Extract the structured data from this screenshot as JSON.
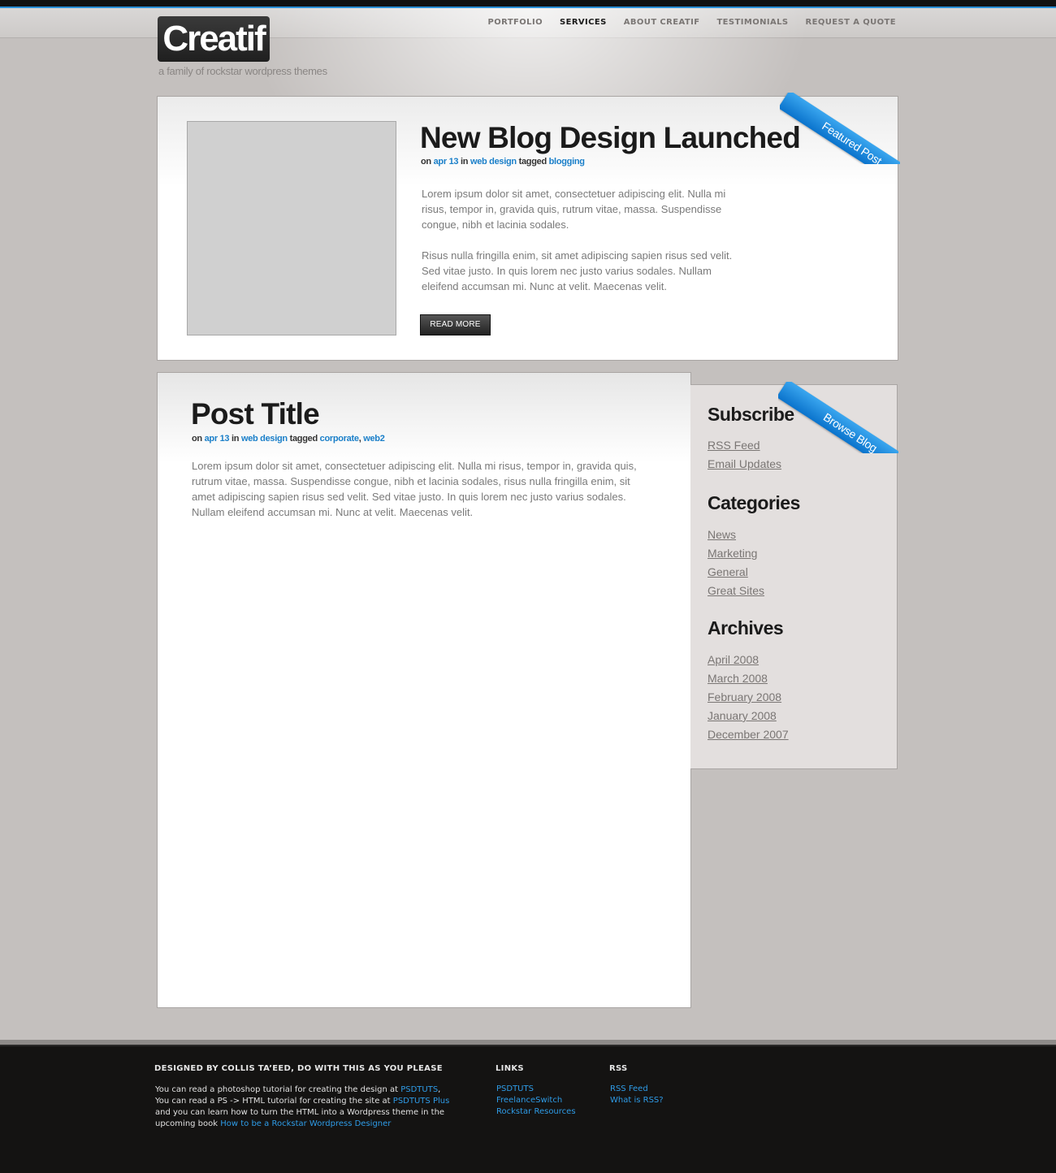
{
  "header": {
    "logo": "Creatif",
    "tagline": "a family of rockstar wordpress themes",
    "nav": [
      "PORTFOLIO",
      "SERVICES",
      "ABOUT CREATIF",
      "TESTIMONIALS",
      "REQUEST A QUOTE"
    ],
    "active_nav": "SERVICES"
  },
  "featured": {
    "ribbon": "Featured Post",
    "title": "New Blog Design Launched",
    "meta": {
      "on": "on",
      "date": "apr 13",
      "in": "in",
      "category": "web design",
      "tagged": "tagged",
      "tags": [
        "blogging"
      ]
    },
    "paragraphs": [
      "Lorem ipsum dolor sit amet, consectetuer adipiscing elit. Nulla mi risus, tempor in, gravida quis, rutrum vitae, massa. Suspendisse congue, nibh et lacinia sodales.",
      "Risus nulla fringilla enim, sit amet adipiscing sapien risus sed velit. Sed vitae justo. In quis lorem nec justo varius sodales. Nullam eleifend accumsan mi. Nunc at velit. Maecenas velit."
    ],
    "read_more": "READ MORE"
  },
  "post": {
    "title": "Post Title",
    "meta": {
      "on": "on",
      "date": "apr 13",
      "in": "in",
      "category": "web design",
      "tagged": "tagged",
      "tags": [
        "corporate",
        "web2"
      ]
    },
    "body": "Lorem ipsum dolor sit amet, consectetuer adipiscing elit. Nulla mi risus, tempor in, gravida quis, rutrum vitae, massa. Suspendisse congue, nibh et lacinia sodales, risus nulla fringilla enim, sit amet adipiscing sapien risus sed velit. Sed vitae justo. In quis lorem nec justo varius sodales. Nullam eleifend accumsan mi. Nunc at velit. Maecenas velit."
  },
  "sidebar": {
    "ribbon": "Browse Blog",
    "subscribe": {
      "heading": "Subscribe",
      "items": [
        "RSS Feed",
        "Email Updates"
      ]
    },
    "categories": {
      "heading": "Categories",
      "items": [
        "News",
        "Marketing",
        "General",
        "Great Sites"
      ]
    },
    "archives": {
      "heading": "Archives",
      "items": [
        "April 2008",
        "March 2008",
        "February 2008",
        "January 2008",
        "December 2007"
      ]
    }
  },
  "footer": {
    "credit_heading": "DESIGNED BY COLLIS TA’EED, DO WITH THIS AS YOU PLEASE",
    "credit_lines": [
      {
        "text": "You can read a photoshop tutorial for creating the design at ",
        "link": "PSDTUTS",
        "after": ","
      },
      {
        "text": "You can read a PS -> HTML tutorial for creating the site at ",
        "link": "PSDTUTS Plus",
        "after": ""
      },
      {
        "text": "and you can learn how to turn the HTML into a Wordpress theme in the",
        "link": "",
        "after": ""
      },
      {
        "text": "upcoming book ",
        "link": "How to be a Rockstar Wordpress Designer",
        "after": ""
      }
    ],
    "links_heading": "LINKS",
    "links": [
      "PSDTUTS",
      "FreelanceSwitch",
      "Rockstar Resources"
    ],
    "rss_heading": "RSS",
    "rss": [
      "RSS Feed",
      "What is RSS?"
    ]
  },
  "colors": {
    "accent": "#1a7fc9",
    "footer_link": "#2e9be6",
    "ribbon": "#1f8ee0",
    "background": "#c4c0be"
  }
}
